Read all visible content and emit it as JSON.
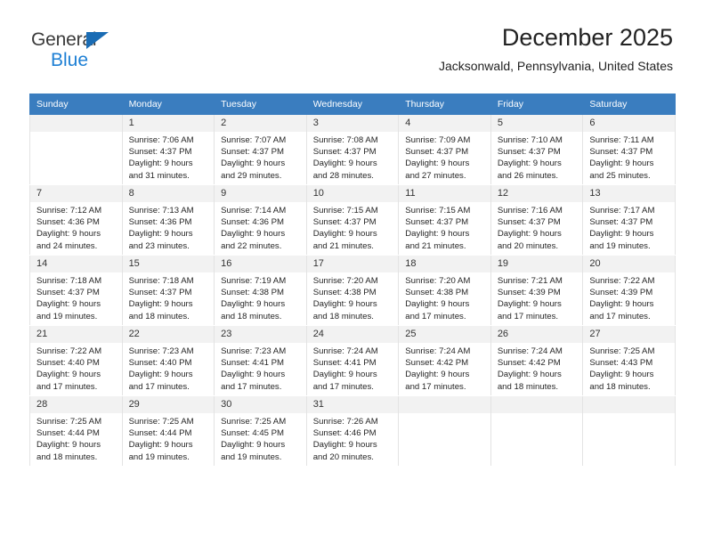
{
  "brand": {
    "name_part1": "General",
    "name_part2": "Blue",
    "triangle_color": "#1a6cb4",
    "blue_color": "#1d7fd4"
  },
  "header": {
    "title": "December 2025",
    "subtitle": "Jacksonwald, Pennsylvania, United States"
  },
  "theme": {
    "header_row_bg": "#3a7dbf",
    "day_number_bg": "#f2f2f2",
    "cell_border": "#e3e3e3",
    "text_color": "#262626"
  },
  "weekdays": [
    "Sunday",
    "Monday",
    "Tuesday",
    "Wednesday",
    "Thursday",
    "Friday",
    "Saturday"
  ],
  "labels": {
    "sunrise_prefix": "Sunrise:",
    "sunset_prefix": "Sunset:",
    "daylight_prefix": "Daylight:"
  },
  "weeks": [
    [
      {
        "day": "",
        "empty": true
      },
      {
        "day": "1",
        "sunrise": "Sunrise: 7:06 AM",
        "sunset": "Sunset: 4:37 PM",
        "daylight_line1": "Daylight: 9 hours",
        "daylight_line2": "and 31 minutes."
      },
      {
        "day": "2",
        "sunrise": "Sunrise: 7:07 AM",
        "sunset": "Sunset: 4:37 PM",
        "daylight_line1": "Daylight: 9 hours",
        "daylight_line2": "and 29 minutes."
      },
      {
        "day": "3",
        "sunrise": "Sunrise: 7:08 AM",
        "sunset": "Sunset: 4:37 PM",
        "daylight_line1": "Daylight: 9 hours",
        "daylight_line2": "and 28 minutes."
      },
      {
        "day": "4",
        "sunrise": "Sunrise: 7:09 AM",
        "sunset": "Sunset: 4:37 PM",
        "daylight_line1": "Daylight: 9 hours",
        "daylight_line2": "and 27 minutes."
      },
      {
        "day": "5",
        "sunrise": "Sunrise: 7:10 AM",
        "sunset": "Sunset: 4:37 PM",
        "daylight_line1": "Daylight: 9 hours",
        "daylight_line2": "and 26 minutes."
      },
      {
        "day": "6",
        "sunrise": "Sunrise: 7:11 AM",
        "sunset": "Sunset: 4:37 PM",
        "daylight_line1": "Daylight: 9 hours",
        "daylight_line2": "and 25 minutes."
      }
    ],
    [
      {
        "day": "7",
        "sunrise": "Sunrise: 7:12 AM",
        "sunset": "Sunset: 4:36 PM",
        "daylight_line1": "Daylight: 9 hours",
        "daylight_line2": "and 24 minutes."
      },
      {
        "day": "8",
        "sunrise": "Sunrise: 7:13 AM",
        "sunset": "Sunset: 4:36 PM",
        "daylight_line1": "Daylight: 9 hours",
        "daylight_line2": "and 23 minutes."
      },
      {
        "day": "9",
        "sunrise": "Sunrise: 7:14 AM",
        "sunset": "Sunset: 4:36 PM",
        "daylight_line1": "Daylight: 9 hours",
        "daylight_line2": "and 22 minutes."
      },
      {
        "day": "10",
        "sunrise": "Sunrise: 7:15 AM",
        "sunset": "Sunset: 4:37 PM",
        "daylight_line1": "Daylight: 9 hours",
        "daylight_line2": "and 21 minutes."
      },
      {
        "day": "11",
        "sunrise": "Sunrise: 7:15 AM",
        "sunset": "Sunset: 4:37 PM",
        "daylight_line1": "Daylight: 9 hours",
        "daylight_line2": "and 21 minutes."
      },
      {
        "day": "12",
        "sunrise": "Sunrise: 7:16 AM",
        "sunset": "Sunset: 4:37 PM",
        "daylight_line1": "Daylight: 9 hours",
        "daylight_line2": "and 20 minutes."
      },
      {
        "day": "13",
        "sunrise": "Sunrise: 7:17 AM",
        "sunset": "Sunset: 4:37 PM",
        "daylight_line1": "Daylight: 9 hours",
        "daylight_line2": "and 19 minutes."
      }
    ],
    [
      {
        "day": "14",
        "sunrise": "Sunrise: 7:18 AM",
        "sunset": "Sunset: 4:37 PM",
        "daylight_line1": "Daylight: 9 hours",
        "daylight_line2": "and 19 minutes."
      },
      {
        "day": "15",
        "sunrise": "Sunrise: 7:18 AM",
        "sunset": "Sunset: 4:37 PM",
        "daylight_line1": "Daylight: 9 hours",
        "daylight_line2": "and 18 minutes."
      },
      {
        "day": "16",
        "sunrise": "Sunrise: 7:19 AM",
        "sunset": "Sunset: 4:38 PM",
        "daylight_line1": "Daylight: 9 hours",
        "daylight_line2": "and 18 minutes."
      },
      {
        "day": "17",
        "sunrise": "Sunrise: 7:20 AM",
        "sunset": "Sunset: 4:38 PM",
        "daylight_line1": "Daylight: 9 hours",
        "daylight_line2": "and 18 minutes."
      },
      {
        "day": "18",
        "sunrise": "Sunrise: 7:20 AM",
        "sunset": "Sunset: 4:38 PM",
        "daylight_line1": "Daylight: 9 hours",
        "daylight_line2": "and 17 minutes."
      },
      {
        "day": "19",
        "sunrise": "Sunrise: 7:21 AM",
        "sunset": "Sunset: 4:39 PM",
        "daylight_line1": "Daylight: 9 hours",
        "daylight_line2": "and 17 minutes."
      },
      {
        "day": "20",
        "sunrise": "Sunrise: 7:22 AM",
        "sunset": "Sunset: 4:39 PM",
        "daylight_line1": "Daylight: 9 hours",
        "daylight_line2": "and 17 minutes."
      }
    ],
    [
      {
        "day": "21",
        "sunrise": "Sunrise: 7:22 AM",
        "sunset": "Sunset: 4:40 PM",
        "daylight_line1": "Daylight: 9 hours",
        "daylight_line2": "and 17 minutes."
      },
      {
        "day": "22",
        "sunrise": "Sunrise: 7:23 AM",
        "sunset": "Sunset: 4:40 PM",
        "daylight_line1": "Daylight: 9 hours",
        "daylight_line2": "and 17 minutes."
      },
      {
        "day": "23",
        "sunrise": "Sunrise: 7:23 AM",
        "sunset": "Sunset: 4:41 PM",
        "daylight_line1": "Daylight: 9 hours",
        "daylight_line2": "and 17 minutes."
      },
      {
        "day": "24",
        "sunrise": "Sunrise: 7:24 AM",
        "sunset": "Sunset: 4:41 PM",
        "daylight_line1": "Daylight: 9 hours",
        "daylight_line2": "and 17 minutes."
      },
      {
        "day": "25",
        "sunrise": "Sunrise: 7:24 AM",
        "sunset": "Sunset: 4:42 PM",
        "daylight_line1": "Daylight: 9 hours",
        "daylight_line2": "and 17 minutes."
      },
      {
        "day": "26",
        "sunrise": "Sunrise: 7:24 AM",
        "sunset": "Sunset: 4:42 PM",
        "daylight_line1": "Daylight: 9 hours",
        "daylight_line2": "and 18 minutes."
      },
      {
        "day": "27",
        "sunrise": "Sunrise: 7:25 AM",
        "sunset": "Sunset: 4:43 PM",
        "daylight_line1": "Daylight: 9 hours",
        "daylight_line2": "and 18 minutes."
      }
    ],
    [
      {
        "day": "28",
        "sunrise": "Sunrise: 7:25 AM",
        "sunset": "Sunset: 4:44 PM",
        "daylight_line1": "Daylight: 9 hours",
        "daylight_line2": "and 18 minutes."
      },
      {
        "day": "29",
        "sunrise": "Sunrise: 7:25 AM",
        "sunset": "Sunset: 4:44 PM",
        "daylight_line1": "Daylight: 9 hours",
        "daylight_line2": "and 19 minutes."
      },
      {
        "day": "30",
        "sunrise": "Sunrise: 7:25 AM",
        "sunset": "Sunset: 4:45 PM",
        "daylight_line1": "Daylight: 9 hours",
        "daylight_line2": "and 19 minutes."
      },
      {
        "day": "31",
        "sunrise": "Sunrise: 7:26 AM",
        "sunset": "Sunset: 4:46 PM",
        "daylight_line1": "Daylight: 9 hours",
        "daylight_line2": "and 20 minutes."
      },
      {
        "day": "",
        "empty": true
      },
      {
        "day": "",
        "empty": true
      },
      {
        "day": "",
        "empty": true
      }
    ]
  ]
}
